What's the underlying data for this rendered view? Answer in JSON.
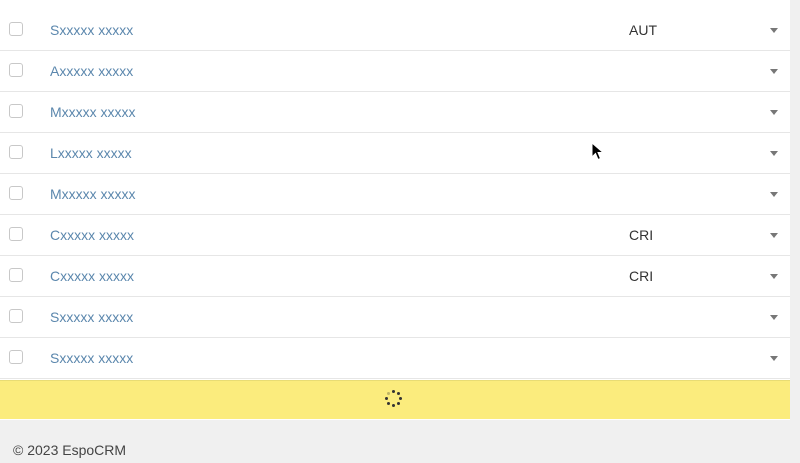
{
  "list": {
    "rows": [
      {
        "name": "Sxxxxx xxxxx",
        "code": "AUT"
      },
      {
        "name": "Axxxxx xxxxx",
        "code": ""
      },
      {
        "name": "Mxxxxx xxxxx",
        "code": ""
      },
      {
        "name": "Lxxxxx xxxxx",
        "code": ""
      },
      {
        "name": "Mxxxxx xxxxx",
        "code": ""
      },
      {
        "name": "Cxxxxx xxxxx",
        "code": "CRI"
      },
      {
        "name": "Cxxxxx xxxxx",
        "code": "CRI"
      },
      {
        "name": "Sxxxxx xxxxx",
        "code": ""
      },
      {
        "name": "Sxxxxx xxxxx",
        "code": ""
      }
    ]
  },
  "loading": {
    "icon": "spinner-icon",
    "color": "#fbec7d"
  },
  "footer": {
    "text": "© 2023 EspoCRM"
  },
  "colors": {
    "link": "#5b87ad",
    "text": "#333333"
  }
}
